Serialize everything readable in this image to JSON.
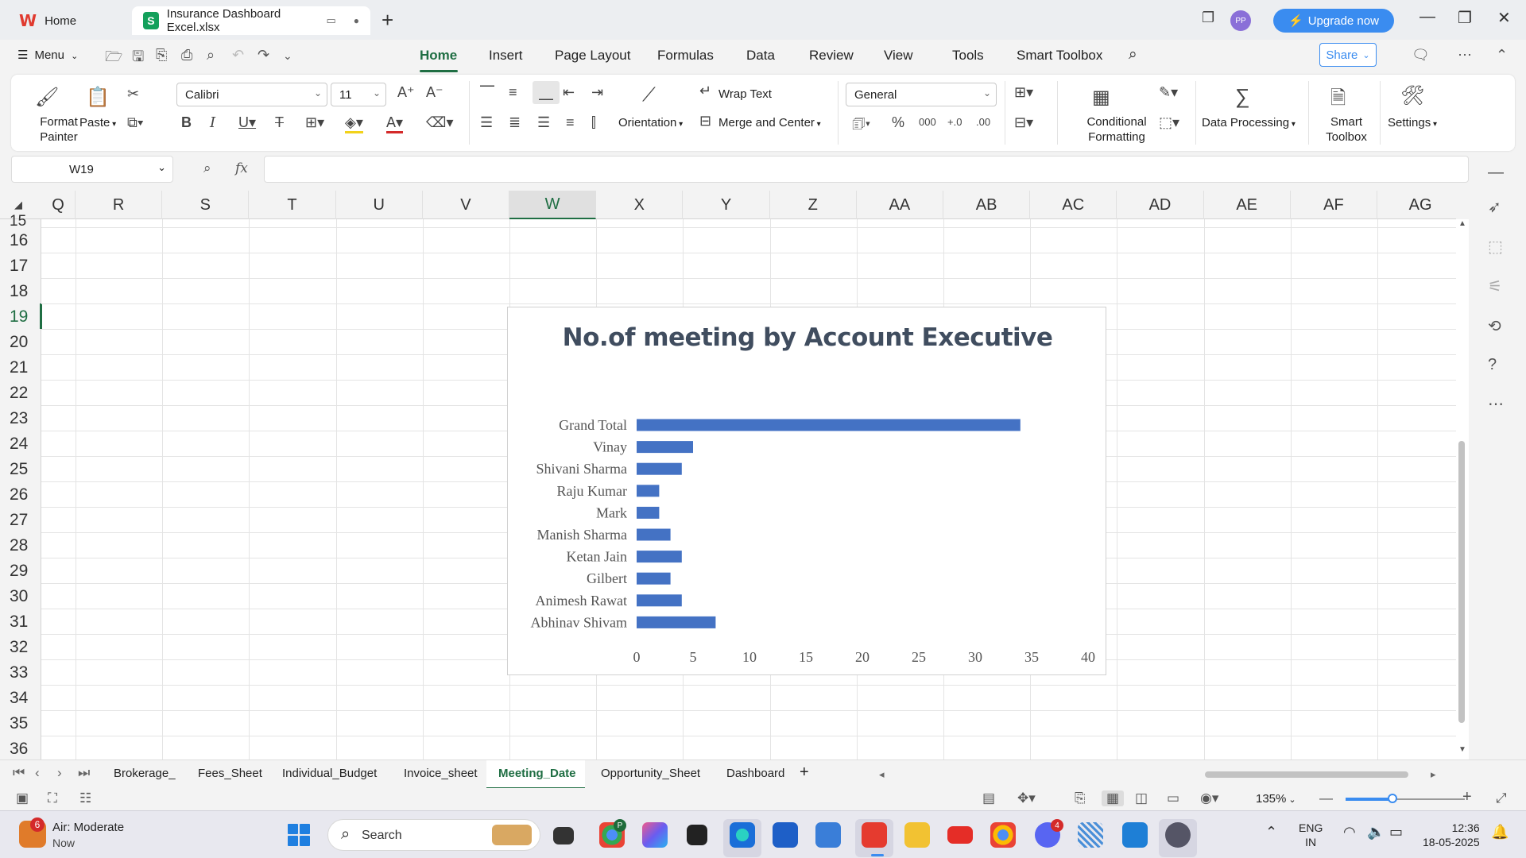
{
  "window": {
    "home_tab": "Home",
    "file_tab": "Insurance Dashboard Excel.xlsx",
    "avatar": "PP",
    "upgrade": "Upgrade now"
  },
  "menubar": {
    "menu": "Menu",
    "tabs": [
      "Home",
      "Insert",
      "Page Layout",
      "Formulas",
      "Data",
      "Review",
      "View",
      "Tools",
      "Smart Toolbox"
    ],
    "share": "Share"
  },
  "ribbon": {
    "format_painter": "Format Painter",
    "paste": "Paste",
    "font_name": "Calibri",
    "font_size": "11",
    "wrap_text": "Wrap Text",
    "orientation": "Orientation",
    "merge_center": "Merge and Center",
    "number_format": "General",
    "conditional_formatting": "Conditional Formatting",
    "data_processing": "Data Processing",
    "smart_toolbox": "Smart Toolbox",
    "settings": "Settings"
  },
  "formula_bar": {
    "cell_ref": "W19",
    "fx": "fx",
    "value": ""
  },
  "grid": {
    "columns": [
      "Q",
      "R",
      "S",
      "T",
      "U",
      "V",
      "W",
      "X",
      "Y",
      "Z",
      "AA",
      "AB",
      "AC",
      "AD",
      "AE",
      "AF",
      "AG"
    ],
    "selected_column": "W",
    "rows": [
      "15",
      "16",
      "17",
      "18",
      "19",
      "20",
      "21",
      "22",
      "23",
      "24",
      "25",
      "26",
      "27",
      "28",
      "29",
      "30",
      "31",
      "32",
      "33",
      "34",
      "35",
      "36"
    ],
    "selected_row": "19"
  },
  "chart_data": {
    "type": "bar",
    "orientation": "horizontal",
    "title": "No.of meeting by Account Executive",
    "categories": [
      "Grand Total",
      "Vinay",
      "Shivani Sharma",
      "Raju Kumar",
      "Mark",
      "Manish Sharma",
      "Ketan Jain",
      "Gilbert",
      "Animesh Rawat",
      "Abhinav Shivam"
    ],
    "values": [
      34,
      5,
      4,
      2,
      2,
      3,
      4,
      3,
      4,
      7
    ],
    "xlim": [
      0,
      40
    ],
    "xticks": [
      "0",
      "5",
      "10",
      "15",
      "20",
      "25",
      "30",
      "35",
      "40"
    ],
    "xlabel": "",
    "ylabel": "",
    "grid": false,
    "bar_color": "#4472c4"
  },
  "sheets": {
    "tabs": [
      "Brokerage_",
      "Fees_Sheet",
      "Individual_Budget",
      "Invoice_sheet",
      "Meeting_Date",
      "Opportunity_Sheet",
      "Dashboard"
    ],
    "active": "Meeting_Date"
  },
  "status": {
    "zoom": "135%",
    "zoom_fraction": 0.4
  },
  "taskbar": {
    "weather_badge": "6",
    "weather_title": "Air: Moderate",
    "weather_sub": "Now",
    "search": "Search",
    "chrome_badge": "P",
    "discord_badge": "4",
    "lang_1": "ENG",
    "lang_2": "IN",
    "time": "12:36",
    "date": "18-05-2025"
  },
  "colors": {
    "accent_green": "#1f6e43",
    "accent_blue": "#3a8cf0",
    "chart_bar": "#4472c4",
    "chart_title": "#404d5f"
  }
}
